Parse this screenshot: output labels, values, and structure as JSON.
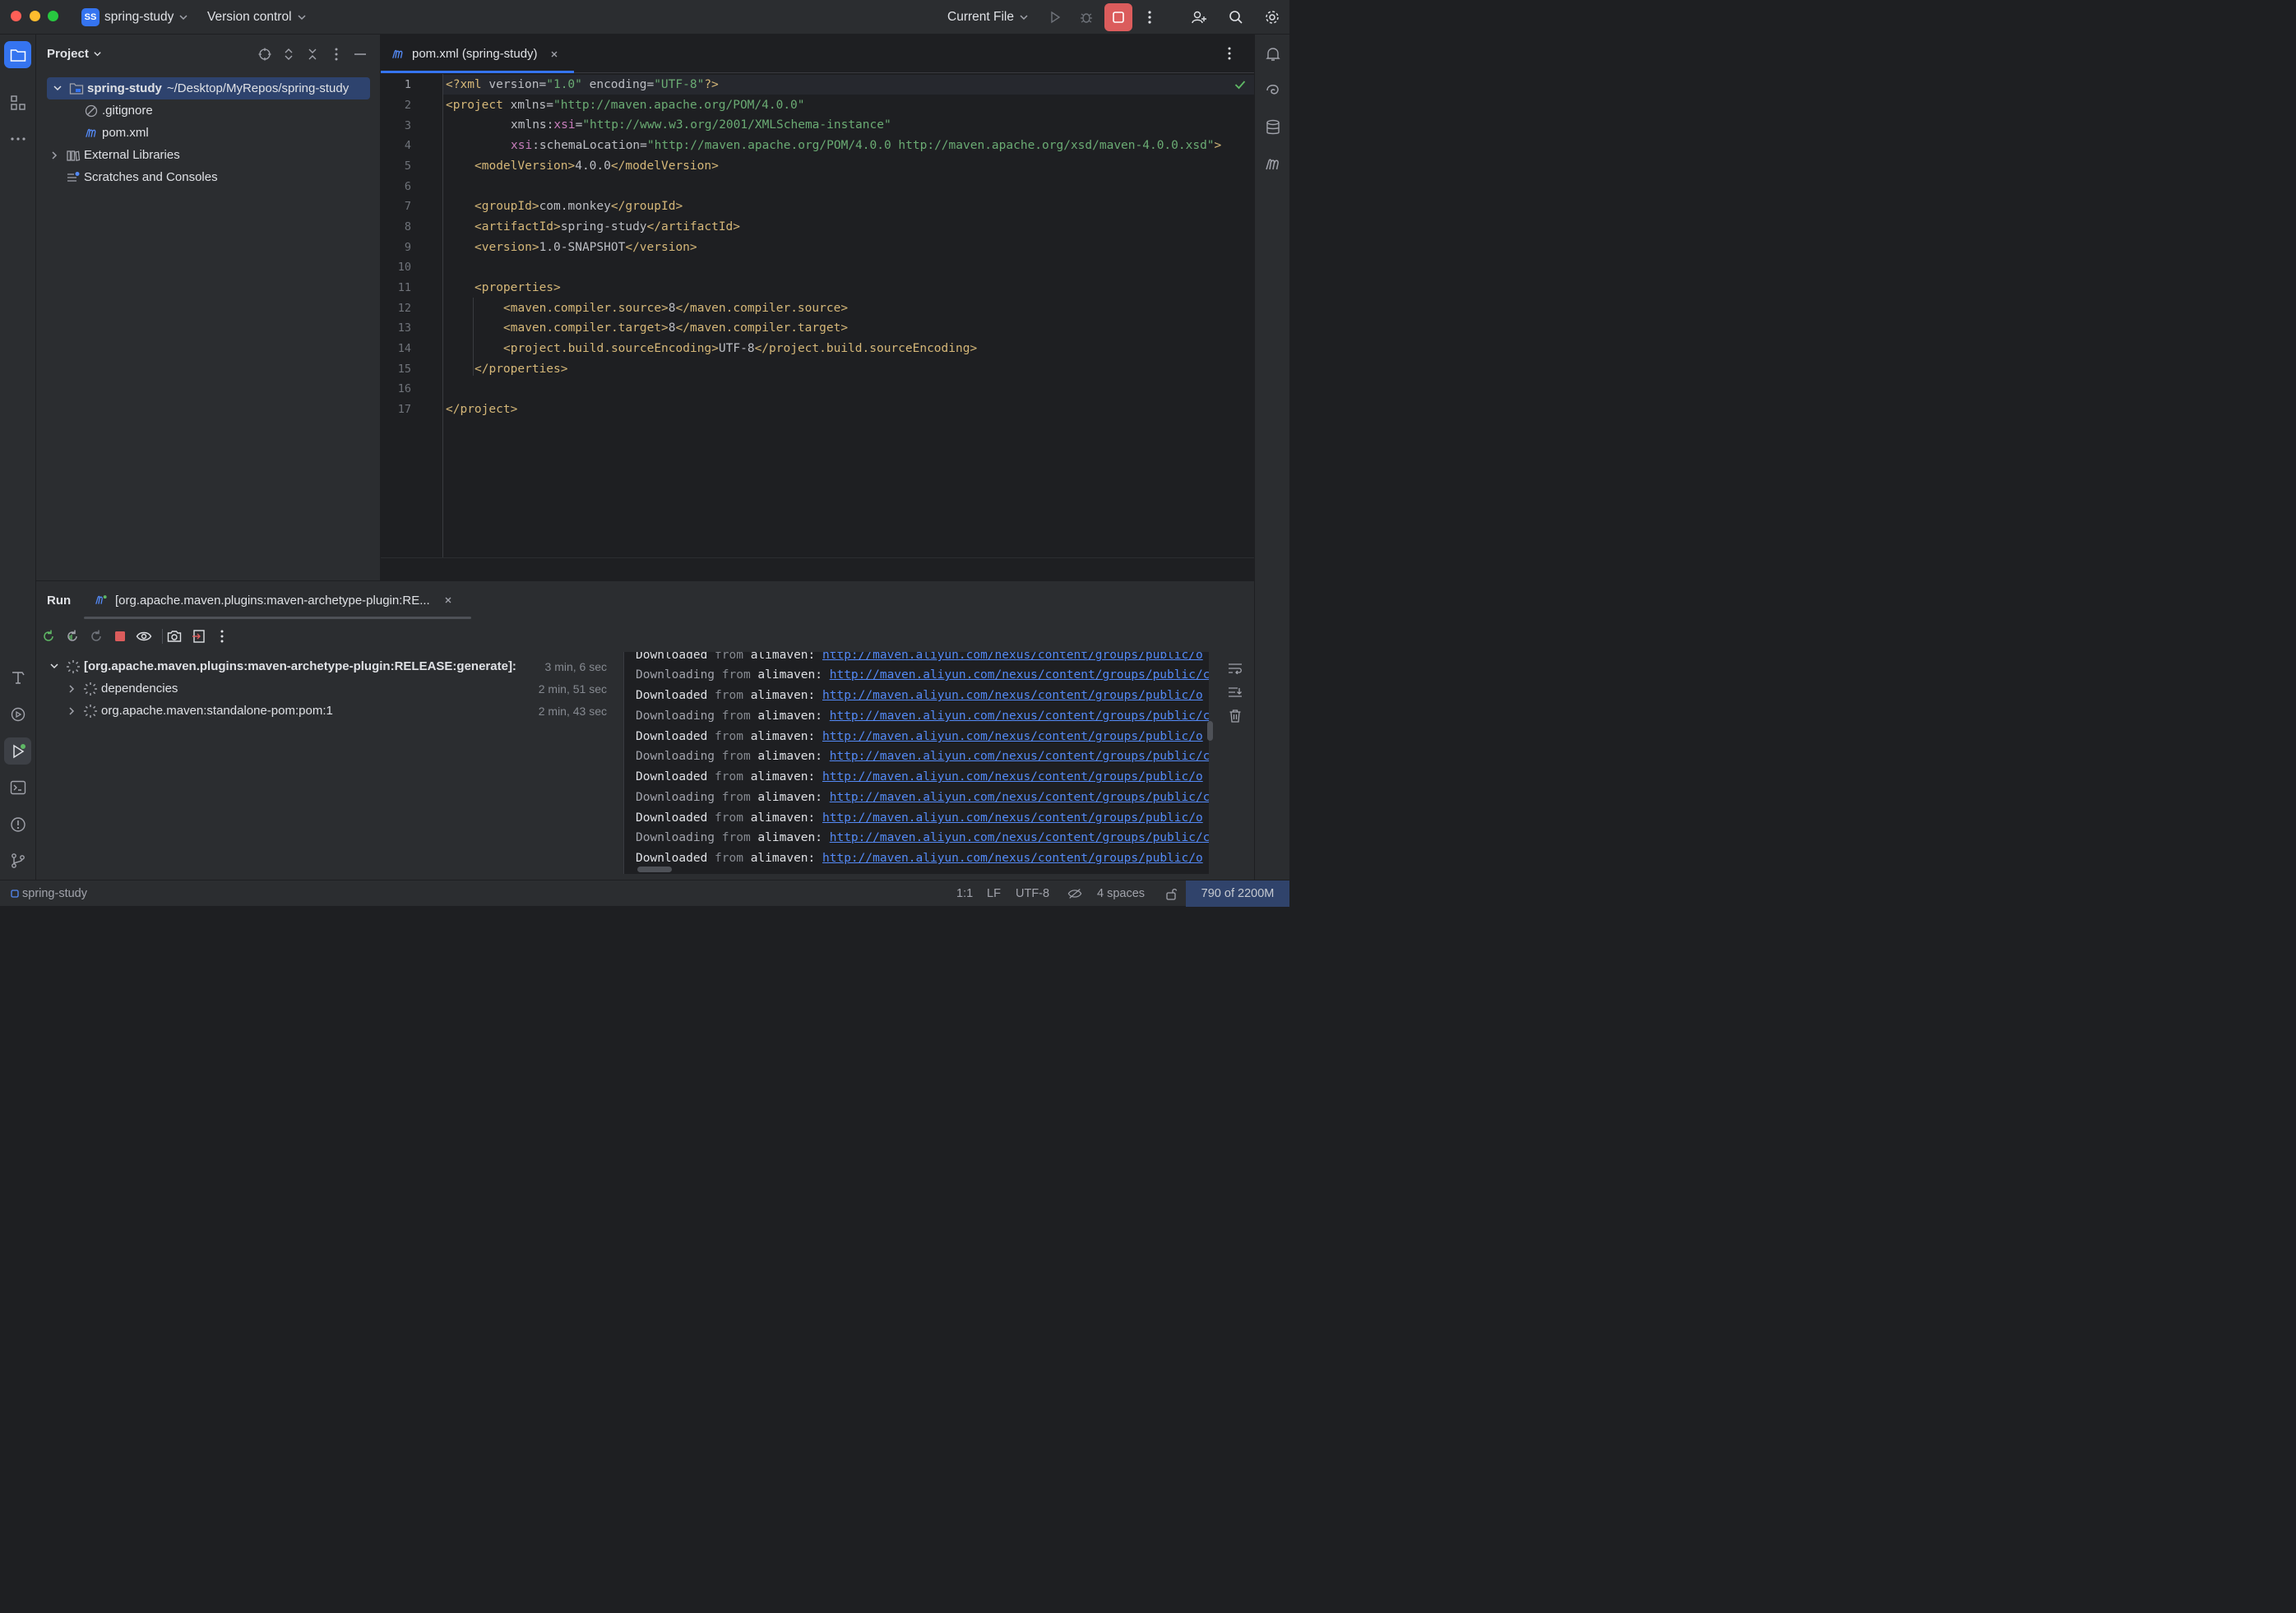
{
  "titlebar": {
    "project_badge": "SS",
    "project_name": "spring-study",
    "vcs_label": "Version control",
    "run_config": "Current File"
  },
  "project_panel": {
    "title": "Project",
    "tree": [
      {
        "label": "spring-study",
        "path": "~/Desktop/MyRepos/spring-study"
      },
      {
        "label": ".gitignore"
      },
      {
        "label": "pom.xml"
      },
      {
        "label": "External Libraries"
      },
      {
        "label": "Scratches and Consoles"
      }
    ]
  },
  "editor": {
    "tab_label": "pom.xml (spring-study)",
    "line_numbers": [
      "1",
      "2",
      "3",
      "4",
      "5",
      "6",
      "7",
      "8",
      "9",
      "10",
      "11",
      "12",
      "13",
      "14",
      "15",
      "16",
      "17"
    ],
    "lines": {
      "l1": {
        "a": "<?xml ",
        "b": "version",
        "c": "=",
        "d": "\"1.0\"",
        "e": " encoding",
        "f": "=",
        "g": "\"UTF-8\"",
        "h": "?>"
      },
      "l2": {
        "a": "<project ",
        "b": "xmlns",
        "c": "=",
        "d": "\"http://maven.apache.org/POM/4.0.0\""
      },
      "l3": {
        "a": "xmlns:",
        "b": "xsi",
        "c": "=",
        "d": "\"http://www.w3.org/2001/XMLSchema-instance\""
      },
      "l4": {
        "a": "xsi",
        "b": ":schemaLocation",
        "c": "=",
        "d": "\"http://maven.apache.org/POM/4.0.0 http://maven.apache.org/xsd/maven-4.0.0.xsd\"",
        "e": ">"
      },
      "l5": {
        "open": "<modelVersion>",
        "text": "4.0.0",
        "close": "</modelVersion>"
      },
      "l7": {
        "open": "<groupId>",
        "text": "com.monkey",
        "close": "</groupId>"
      },
      "l8": {
        "open": "<artifactId>",
        "text": "spring-study",
        "close": "</artifactId>"
      },
      "l9": {
        "open": "<version>",
        "text": "1.0-SNAPSHOT",
        "close": "</version>"
      },
      "l11": {
        "open": "<properties>"
      },
      "l12": {
        "open": "<maven.compiler.source>",
        "text": "8",
        "close": "</maven.compiler.source>"
      },
      "l13": {
        "open": "<maven.compiler.target>",
        "text": "8",
        "close": "</maven.compiler.target>"
      },
      "l14": {
        "open": "<project.build.sourceEncoding>",
        "text": "UTF-8",
        "close": "</project.build.sourceEncoding>"
      },
      "l15": {
        "close": "</properties>"
      },
      "l17": {
        "close": "</project>"
      }
    }
  },
  "run_panel": {
    "label": "Run",
    "tab_label": "[org.apache.maven.plugins:maven-archetype-plugin:RE...",
    "tree": [
      {
        "label": "[org.apache.maven.plugins:maven-archetype-plugin:RELEASE:generate]:",
        "time": "3 min, 6 sec"
      },
      {
        "label": "dependencies",
        "time": "2 min, 51 sec"
      },
      {
        "label": "org.apache.maven:standalone-pom:pom:1",
        "time": "2 min, 43 sec"
      }
    ],
    "console": [
      {
        "verb": "Downloaded",
        "from": "from",
        "repo": "alimaven:",
        "url": "http://maven.aliyun.com/nexus/content/groups/public/o"
      },
      {
        "verb": "Downloading",
        "from": "from",
        "repo": "alimaven:",
        "url": "http://maven.aliyun.com/nexus/content/groups/public/c"
      },
      {
        "verb": "Downloaded",
        "from": "from",
        "repo": "alimaven:",
        "url": "http://maven.aliyun.com/nexus/content/groups/public/o"
      },
      {
        "verb": "Downloading",
        "from": "from",
        "repo": "alimaven:",
        "url": "http://maven.aliyun.com/nexus/content/groups/public/c"
      },
      {
        "verb": "Downloaded",
        "from": "from",
        "repo": "alimaven:",
        "url": "http://maven.aliyun.com/nexus/content/groups/public/o"
      },
      {
        "verb": "Downloading",
        "from": "from",
        "repo": "alimaven:",
        "url": "http://maven.aliyun.com/nexus/content/groups/public/c"
      },
      {
        "verb": "Downloaded",
        "from": "from",
        "repo": "alimaven:",
        "url": "http://maven.aliyun.com/nexus/content/groups/public/o"
      },
      {
        "verb": "Downloading",
        "from": "from",
        "repo": "alimaven:",
        "url": "http://maven.aliyun.com/nexus/content/groups/public/c"
      },
      {
        "verb": "Downloaded",
        "from": "from",
        "repo": "alimaven:",
        "url": "http://maven.aliyun.com/nexus/content/groups/public/o"
      },
      {
        "verb": "Downloading",
        "from": "from",
        "repo": "alimaven:",
        "url": "http://maven.aliyun.com/nexus/content/groups/public/c"
      },
      {
        "verb": "Downloaded",
        "from": "from",
        "repo": "alimaven:",
        "url": "http://maven.aliyun.com/nexus/content/groups/public/o"
      }
    ]
  },
  "statusbar": {
    "project": "spring-study",
    "position": "1:1",
    "line_sep": "LF",
    "encoding": "UTF-8",
    "indent": "4 spaces",
    "memory": "790 of 2200M"
  },
  "colors": {
    "accent": "#3574f0",
    "stop": "#db5c5c",
    "tag": "#d5b778",
    "string": "#6aab73",
    "link": "#548af7"
  },
  "icons": [
    "project-icon",
    "structure-icon",
    "more-icon",
    "build-icon",
    "services-icon",
    "run-icon",
    "terminal-icon",
    "problems-icon",
    "git-icon",
    "notifications-icon",
    "ai-icon",
    "database-icon",
    "maven-icon",
    "run-play-icon",
    "debug-icon",
    "stop-icon",
    "add-user-icon",
    "search-icon",
    "settings-icon"
  ]
}
